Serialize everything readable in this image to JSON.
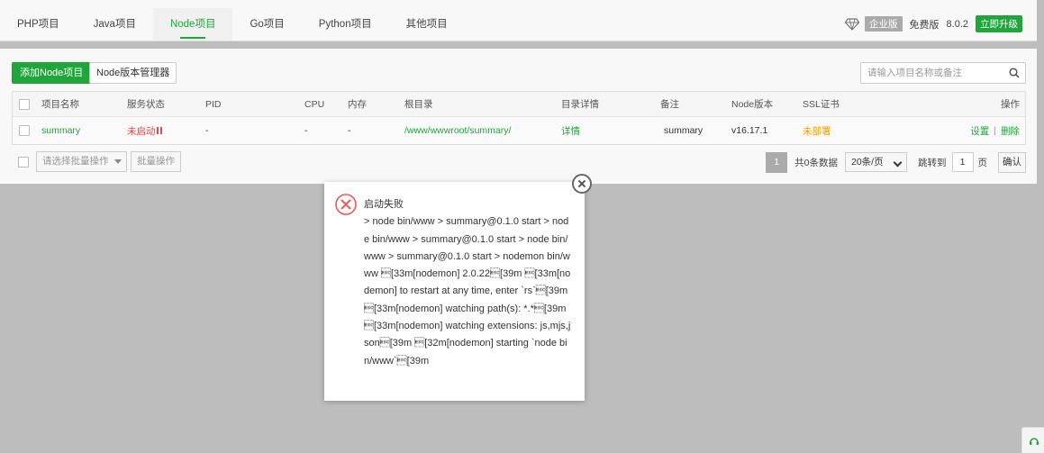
{
  "tabs": [
    "PHP项目",
    "Java项目",
    "Node项目",
    "Go项目",
    "Python项目",
    "其他项目"
  ],
  "active_tab": 2,
  "version": {
    "edition_badge": "企业版",
    "free_label": "免费版",
    "number": "8.0.2",
    "upgrade_label": "立即升级"
  },
  "toolbar": {
    "add_label": "添加Node项目",
    "manager_label": "Node版本管理器",
    "search_placeholder": "请输入项目名称或备注"
  },
  "table": {
    "headers": {
      "name": "项目名称",
      "status": "服务状态",
      "pid": "PID",
      "cpu": "CPU",
      "mem": "内存",
      "root": "根目录",
      "detail": "目录详情",
      "remark": "备注",
      "node_version": "Node版本",
      "ssl": "SSL证书",
      "actions": "操作"
    },
    "rows": [
      {
        "name": "summary",
        "status": "未启动",
        "pid": "-",
        "cpu": "-",
        "mem": "-",
        "root": "/www/wwwroot/summary/",
        "detail": "详情",
        "remark": "summary",
        "node_version": "v16.17.1",
        "ssl": "未部署",
        "action_settings": "设置",
        "action_separator": "|",
        "action_delete": "删除"
      }
    ]
  },
  "footer": {
    "batch_placeholder": "请选择批量操作",
    "batch_button": "批量操作",
    "current_page": "1",
    "total_text": "共0条数据",
    "page_size": "20条/页",
    "jump_label": "跳转到",
    "jump_value": "1",
    "page_unit": "页",
    "confirm_label": "确认"
  },
  "dialog": {
    "title": "启动失败",
    "message": "> node bin/www > summary@0.1.0 start > node bin/www > summary@0.1.0 start > node bin/www > summary@0.1.0 start > nodemon bin/www \u001b[33m[nodemon] 2.0.22\u001b[39m \u001b[33m[nodemon] to restart at any time, enter `rs`\u001b[39m \u001b[33m[nodemon] watching path(s): *.*\u001b[39m \u001b[33m[nodemon] watching extensions: js,mjs,json\u001b[39m \u001b[32m[nodemon] starting `node bin/www`\u001b[39m"
  },
  "colors": {
    "accent": "#20a53a",
    "error": "#ee4444",
    "warning": "#f0a000"
  },
  "icons": {
    "edition": "diamond-icon",
    "search": "search-icon",
    "error": "error-circle-icon",
    "close": "close-icon",
    "corner": "support-icon"
  }
}
